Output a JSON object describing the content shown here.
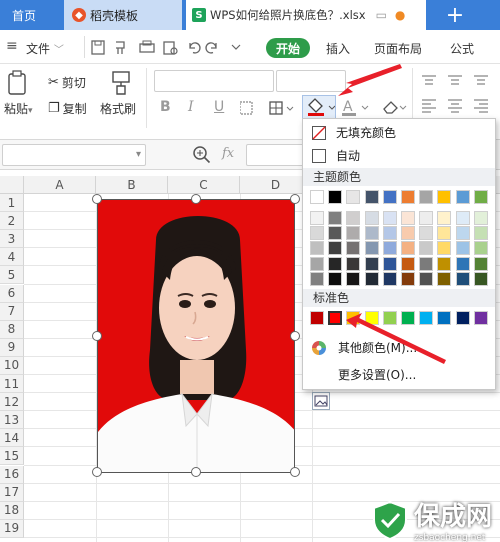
{
  "tabs": {
    "home": "首页",
    "template": "稻壳模板",
    "file": "WPS如何给照片换底色？.xlsx",
    "plus": "+"
  },
  "menu": {
    "file": "文件",
    "start": "开始",
    "insert": "插入",
    "page_layout": "页面布局",
    "formula": "公式"
  },
  "ribbon": {
    "paste": "粘贴",
    "cut": "剪切",
    "copy": "复制",
    "format_painter": "格式刷",
    "bold": "B",
    "italic": "I",
    "underline": "U"
  },
  "formula_bar": {
    "fx": "fx"
  },
  "columns": [
    "A",
    "B",
    "C",
    "D"
  ],
  "rows": [
    "1",
    "2",
    "3",
    "4",
    "5",
    "6",
    "7",
    "8",
    "9",
    "10",
    "11",
    "12",
    "13",
    "14",
    "15",
    "16",
    "17",
    "18",
    "19"
  ],
  "fill_menu": {
    "no_fill": "无填充颜色",
    "auto": "自动",
    "theme_colors": "主题颜色",
    "standard_colors": "标准色",
    "other_colors": "其他颜色(M)...",
    "more_settings": "更多设置(O)...",
    "theme_top": [
      "#ffffff",
      "#000000",
      "#e7e6e6",
      "#44546a",
      "#4472c4",
      "#ed7d31",
      "#a5a5a5",
      "#ffc000",
      "#5b9bd5",
      "#70ad47"
    ],
    "theme_shades": [
      [
        "#f2f2f2",
        "#7f7f7f",
        "#d0cece",
        "#d6dce4",
        "#d9e2f3",
        "#fbe5d6",
        "#ededed",
        "#fff2cc",
        "#deebf7",
        "#e2f0d9"
      ],
      [
        "#d9d9d9",
        "#595959",
        "#aeabab",
        "#adb9ca",
        "#b4c7e7",
        "#f8cbad",
        "#dbdbdb",
        "#ffe699",
        "#bdd7ee",
        "#c5e0b4"
      ],
      [
        "#bfbfbf",
        "#404040",
        "#757171",
        "#8497b0",
        "#8faadc",
        "#f4b183",
        "#c9c9c9",
        "#ffd966",
        "#9dc3e6",
        "#a9d18e"
      ],
      [
        "#a6a6a6",
        "#262626",
        "#3a3838",
        "#333f50",
        "#2f5597",
        "#c55a11",
        "#7b7b7b",
        "#bf9000",
        "#2e75b6",
        "#548235"
      ],
      [
        "#808080",
        "#0d0d0d",
        "#171616",
        "#222a35",
        "#1f3864",
        "#843c0c",
        "#525252",
        "#7f6000",
        "#1f4e79",
        "#385723"
      ]
    ],
    "standard": [
      "#c00000",
      "#ff0000",
      "#ffc000",
      "#ffff00",
      "#92d050",
      "#00b050",
      "#00b0f0",
      "#0070c0",
      "#002060",
      "#7030a0"
    ]
  },
  "watermark": {
    "brand": "保成网",
    "url": "zsbaocheng.net"
  },
  "accent_colors": {
    "tab_blue": "#3a7fd8",
    "start_green": "#2e9c4a",
    "photo_red": "#e10a0a",
    "arrow_red": "#e8202a"
  }
}
